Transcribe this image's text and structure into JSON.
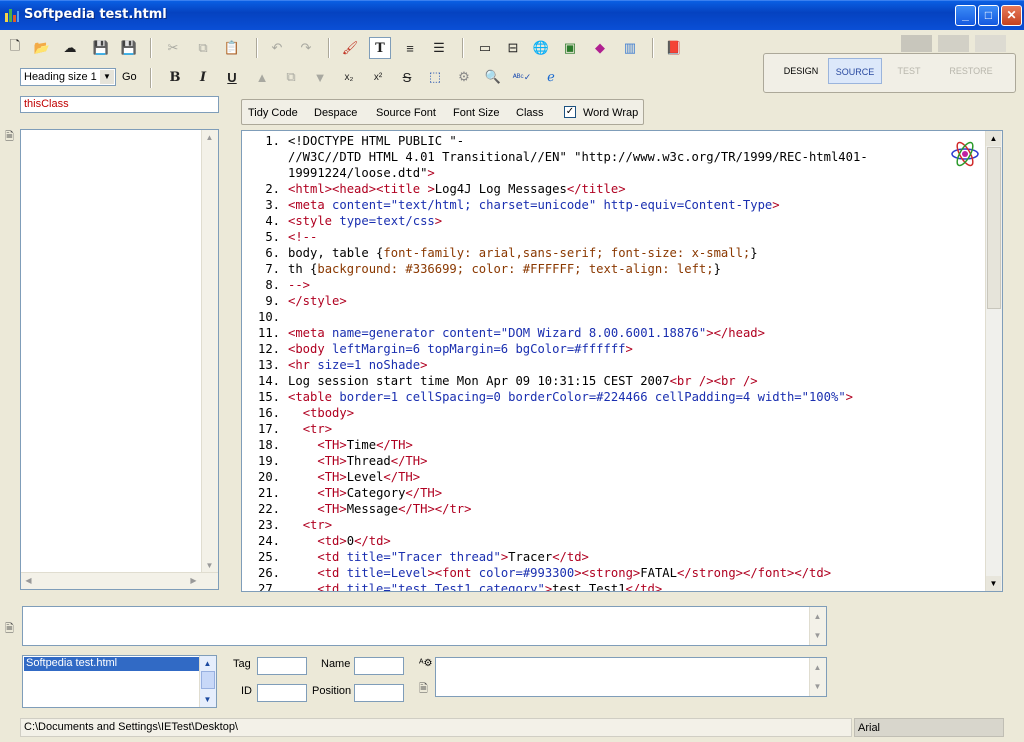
{
  "window": {
    "title": "Softpedia test.html",
    "min": "_",
    "max": "□",
    "close": "✕"
  },
  "toolbar": {
    "heading_select": "Heading size 1",
    "go": "Go"
  },
  "modes": {
    "design": "DESIGN",
    "source": "SOURCE",
    "test": "TEST",
    "restore": "RESTORE"
  },
  "class_field": "thisClass",
  "source_toolbar": {
    "tidy": "Tidy Code",
    "despace": "Despace",
    "source_font": "Source Font",
    "font_size": "Font Size",
    "class": "Class",
    "word_wrap": "Word Wrap",
    "word_wrap_checked": true
  },
  "code": [
    [
      "1.",
      "<!DOCTYPE HTML PUBLIC \"-"
    ],
    [
      "",
      "//W3C//DTD HTML 4.01 Transitional//EN\" \"http://www.w3c.org/TR/1999/REC-html401-"
    ],
    [
      "",
      "19991224/loose.dtd\">"
    ],
    [
      "2.",
      "<html><head><title >Log4J Log Messages</title>"
    ],
    [
      "3.",
      "<meta content=\"text/html; charset=unicode\" http-equiv=Content-Type>"
    ],
    [
      "4.",
      "<style type=text/css>"
    ],
    [
      "5.",
      "<!--"
    ],
    [
      "6.",
      "body, table {font-family: arial,sans-serif; font-size: x-small;}"
    ],
    [
      "7.",
      "th {background: #336699; color: #FFFFFF; text-align: left;}"
    ],
    [
      "8.",
      "-->"
    ],
    [
      "9.",
      "</style>"
    ],
    [
      "10.",
      ""
    ],
    [
      "11.",
      "<meta name=generator content=\"DOM Wizard 8.00.6001.18876\"></head>"
    ],
    [
      "12.",
      "<body leftMargin=6 topMargin=6 bgColor=#ffffff>"
    ],
    [
      "13.",
      "<hr size=1 noShade>"
    ],
    [
      "14.",
      "Log session start time Mon Apr 09 10:31:15 CEST 2007<br /><br />"
    ],
    [
      "15.",
      "<table border=1 cellSpacing=0 borderColor=#224466 cellPadding=4 width=\"100%\">"
    ],
    [
      "16.",
      "  <tbody>"
    ],
    [
      "17.",
      "  <tr>"
    ],
    [
      "18.",
      "    <TH>Time</TH>"
    ],
    [
      "19.",
      "    <TH>Thread</TH>"
    ],
    [
      "20.",
      "    <TH>Level</TH>"
    ],
    [
      "21.",
      "    <TH>Category</TH>"
    ],
    [
      "22.",
      "    <TH>Message</TH></tr>"
    ],
    [
      "23.",
      "  <tr>"
    ],
    [
      "24.",
      "    <td>0</td>"
    ],
    [
      "25.",
      "    <td title=\"Tracer thread\">Tracer</td>"
    ],
    [
      "26.",
      "    <td title=Level><font color=#993300><strong>FATAL</strong></font></td>"
    ],
    [
      "27.",
      "    <td title=\"test.Test1 category\">test.Test1</td>"
    ]
  ],
  "file_list": [
    "Softpedia test.html"
  ],
  "props": {
    "tag": "Tag",
    "name": "Name",
    "id": "ID",
    "position": "Position"
  },
  "status": {
    "path": "C:\\Documents and Settings\\IETest\\Desktop\\",
    "font": "Arial"
  }
}
